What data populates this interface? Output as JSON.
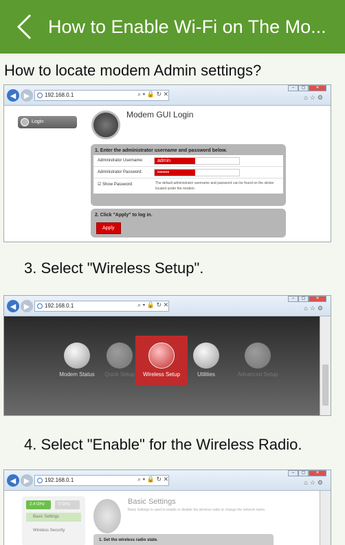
{
  "appbar": {
    "title": "How to Enable Wi-Fi on The Mo..."
  },
  "section_heading": "How to locate modem Admin settings?",
  "browser": {
    "address": "192.168.0.1",
    "addr_tools": "⌕ ▾ 🔒 ↻ ✕"
  },
  "shot1": {
    "login_tab": "Login",
    "gui_title": "Modem GUI Login",
    "step1_head": "1. Enter the administrator username and password below.",
    "username_label": "Administrator Username:",
    "username_value": "admin",
    "password_label": "Administrator Password:",
    "password_value": "•••••••",
    "show_password": "Show Password",
    "note": "The default administrator username and password can be found on the sticker located under the modem.",
    "step2_head": "2. Click \"Apply\" to log in.",
    "apply": "Apply"
  },
  "step3": "3. Select \"Wireless Setup\".",
  "shot2": {
    "items": [
      {
        "label": "Modem Status"
      },
      {
        "label": "Quick Setup"
      },
      {
        "label": "Wireless Setup"
      },
      {
        "label": "Utilities"
      },
      {
        "label": "Advanced Setup"
      }
    ]
  },
  "step4": "4. Select \"Enable\" for the Wireless Radio.",
  "shot3": {
    "freq_24": "2.4 GHz",
    "freq_5": "5 GHz",
    "side_items": [
      "Basic Settings",
      "Wireless Security"
    ],
    "title": "Basic Settings",
    "desc": "Basic Settings is used to enable or disable the wireless radio or change the network name.",
    "bar": "1. Set the wireless radio state."
  },
  "colors": {
    "appbar": "#5c9b2f",
    "brand_red": "#d40000"
  }
}
